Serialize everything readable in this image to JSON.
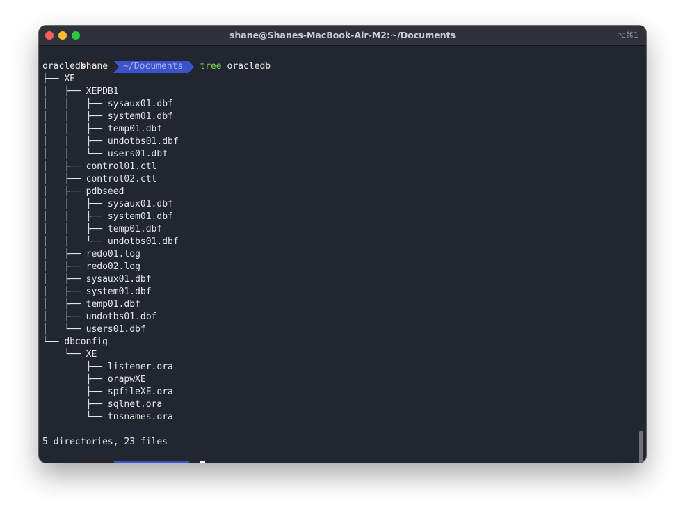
{
  "window": {
    "title": "shane@Shanes-MacBook-Air-M2:~/Documents",
    "shortcut": "⌥⌘1"
  },
  "prompt": {
    "user": "shane",
    "directory": "~/Documents"
  },
  "command": {
    "name": "tree",
    "argument": "oracledb"
  },
  "tree": [
    {
      "prefix": "",
      "name": "oracledb"
    },
    {
      "prefix": "├── ",
      "name": "XE"
    },
    {
      "prefix": "│   ├── ",
      "name": "XEPDB1"
    },
    {
      "prefix": "│   │   ├── ",
      "name": "sysaux01.dbf"
    },
    {
      "prefix": "│   │   ├── ",
      "name": "system01.dbf"
    },
    {
      "prefix": "│   │   ├── ",
      "name": "temp01.dbf"
    },
    {
      "prefix": "│   │   ├── ",
      "name": "undotbs01.dbf"
    },
    {
      "prefix": "│   │   └── ",
      "name": "users01.dbf"
    },
    {
      "prefix": "│   ├── ",
      "name": "control01.ctl"
    },
    {
      "prefix": "│   ├── ",
      "name": "control02.ctl"
    },
    {
      "prefix": "│   ├── ",
      "name": "pdbseed"
    },
    {
      "prefix": "│   │   ├── ",
      "name": "sysaux01.dbf"
    },
    {
      "prefix": "│   │   ├── ",
      "name": "system01.dbf"
    },
    {
      "prefix": "│   │   ├── ",
      "name": "temp01.dbf"
    },
    {
      "prefix": "│   │   └── ",
      "name": "undotbs01.dbf"
    },
    {
      "prefix": "│   ├── ",
      "name": "redo01.log"
    },
    {
      "prefix": "│   ├── ",
      "name": "redo02.log"
    },
    {
      "prefix": "│   ├── ",
      "name": "sysaux01.dbf"
    },
    {
      "prefix": "│   ├── ",
      "name": "system01.dbf"
    },
    {
      "prefix": "│   ├── ",
      "name": "temp01.dbf"
    },
    {
      "prefix": "│   ├── ",
      "name": "undotbs01.dbf"
    },
    {
      "prefix": "│   └── ",
      "name": "users01.dbf"
    },
    {
      "prefix": "└── ",
      "name": "dbconfig"
    },
    {
      "prefix": "    └── ",
      "name": "XE"
    },
    {
      "prefix": "        ├── ",
      "name": "listener.ora"
    },
    {
      "prefix": "        ├── ",
      "name": "orapwXE"
    },
    {
      "prefix": "        ├── ",
      "name": "spfileXE.ora"
    },
    {
      "prefix": "        ├── ",
      "name": "sqlnet.ora"
    },
    {
      "prefix": "        └── ",
      "name": "tnsnames.ora"
    }
  ],
  "summary": "5 directories, 23 files",
  "colors": {
    "background": "#222631",
    "prompt_dir": "#3c53c9",
    "command": "#7fd24a"
  }
}
